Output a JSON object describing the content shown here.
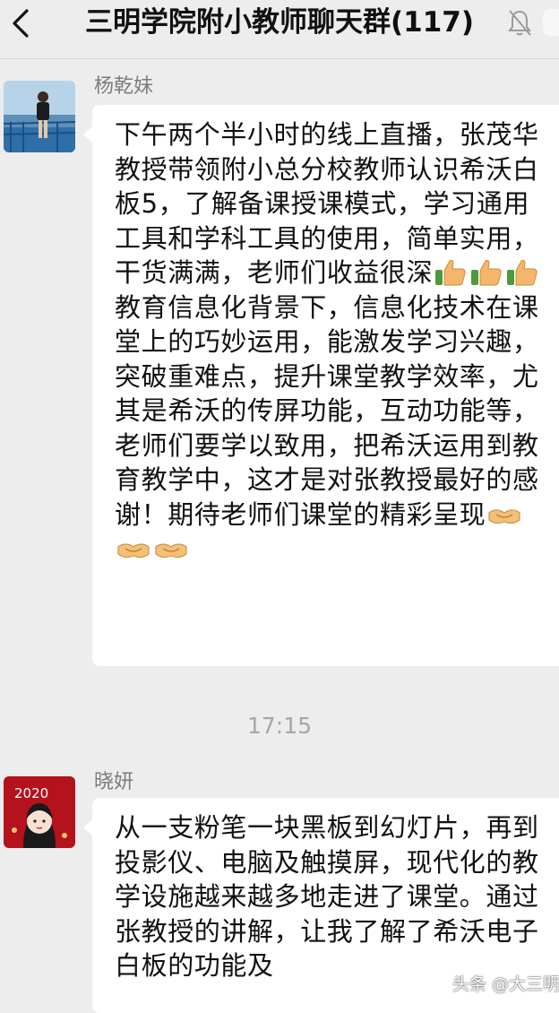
{
  "header": {
    "title": "三明学院附小教师聊天群(117)",
    "back_icon": "chevron-left-icon",
    "mute_icon": "bell-muted-icon"
  },
  "messages": [
    {
      "sender": "杨乾妹",
      "avatar": "photo-avatar",
      "text_before_emoji": "下午两个半小时的线上直播，张茂华教授带领附小总分校教师认识希沃白板5，了解备课授课模式，学习通用工具和学科工具的使用，简单实用，干货满满，老师们收益很深",
      "emoji_1": "thumbs-up-icon",
      "text_middle": "教育信息化背景下，信息化技术在课堂上的巧妙运用，能激发学习兴趣，突破重难点，提升课堂教学效率，尤其是希沃的传屏功能，互动功能等，老师们要学以致用，把希沃运用到教育教学中，这才是对张教授最好的感谢！期待老师们课堂的精彩呈现",
      "emoji_2": "handshake-icon"
    },
    {
      "sender": "晓妍",
      "avatar": "illustrated-avatar",
      "avatar_text": "2020",
      "text": "从一支粉笔一块黑板到幻灯片，再到投影仪、电脑及触摸屏，现代化的教学设施越来越多地走进了课堂。通过张教授的讲解，让我了解了希沃电子白板的功能及"
    }
  ],
  "timestamp": "17:15",
  "watermark": "头条 @大三明",
  "colors": {
    "background": "#ededed",
    "bubble": "#ffffff",
    "meta_text": "#7c7c7c"
  }
}
